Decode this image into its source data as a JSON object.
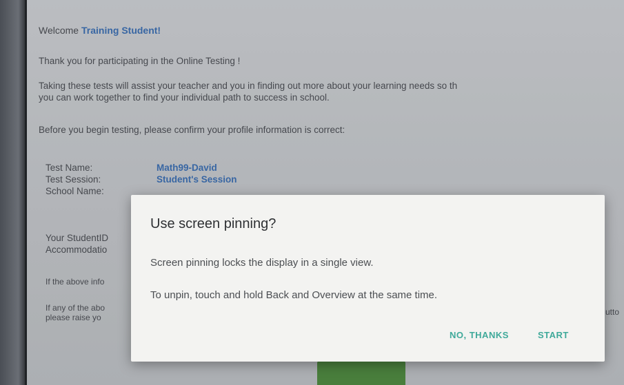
{
  "page": {
    "welcome_prefix": "Welcome ",
    "student_name": "Training Student!",
    "thanks": "Thank you for participating in the Online Testing !",
    "assist_line1": "Taking these tests will assist your teacher and you in finding out more about your learning needs so th",
    "assist_line2": "you can work together to find your individual path to success in school.",
    "confirm": "Before you begin testing, please confirm your profile information is correct:",
    "profile": [
      {
        "label": "Test Name:",
        "value": "Math99-David"
      },
      {
        "label": "Test Session:",
        "value": "Student's Session"
      },
      {
        "label": "School Name:",
        "value": ""
      }
    ],
    "student_id_label": "Your StudentID",
    "accommodations_label": "Accommodatio",
    "if_above": "If the above info",
    "if_any_line1": "If any of the abo",
    "if_any_line2": "please raise yo",
    "right_fragment": "utto"
  },
  "dialog": {
    "title": "Use screen pinning?",
    "line1": "Screen pinning locks the display in a single view.",
    "line2": "To unpin, touch and hold Back and Overview at the same time.",
    "no_thanks": "NO, THANKS",
    "start": "START"
  },
  "colors": {
    "accent_blue": "#3b6fb3",
    "dialog_button": "#3fa99a",
    "confirm_button_green": "#4e8a3e"
  }
}
